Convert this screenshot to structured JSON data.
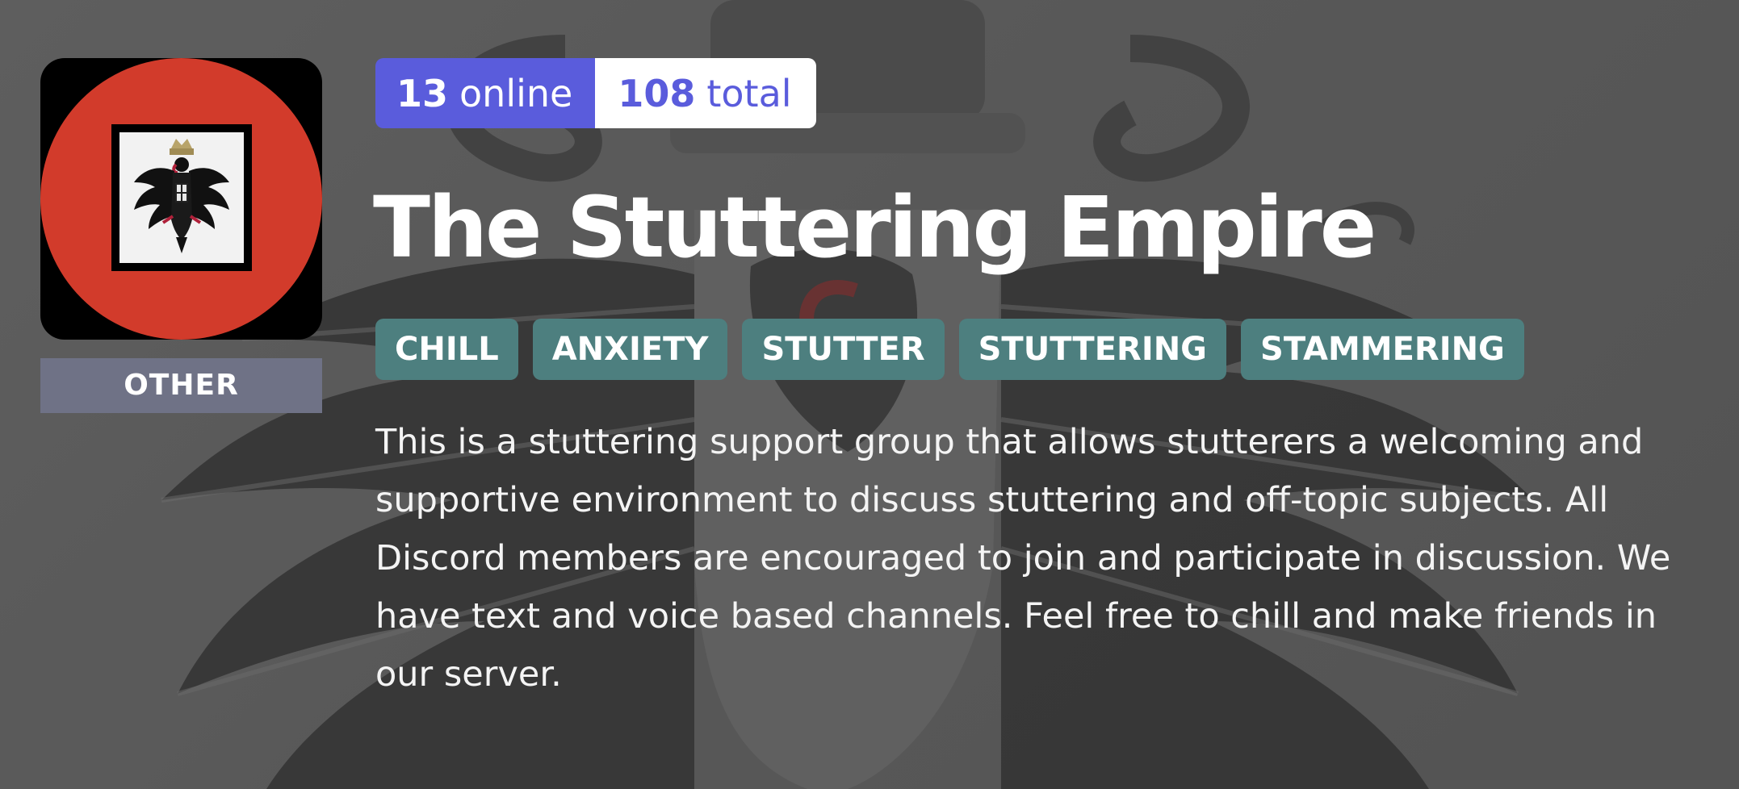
{
  "server": {
    "category": "OTHER",
    "online_count": "13",
    "online_label": "online",
    "total_count": "108",
    "total_label": "total",
    "title": "The Stuttering Empire",
    "tags": [
      "CHILL",
      "ANXIETY",
      "STUTTER",
      "STUTTERING",
      "STAMMERING"
    ],
    "description": "This is a stuttering support group that allows stutterers a welcoming and supportive environment to discuss stuttering and off-topic subjects. All Discord members are encouraged to join and participate in discussion. We have text and voice based channels. Feel free to chill and make friends in our server."
  },
  "icons": {
    "server_icon": "imperial-eagle-icon",
    "background": "imperial-eagle-crest"
  },
  "colors": {
    "online_bg": "#5a5cdc",
    "total_text": "#5a5cdc",
    "tag_bg": "#4d7f7f",
    "category_bg": "#6f7286",
    "icon_red": "#d23b2b"
  }
}
